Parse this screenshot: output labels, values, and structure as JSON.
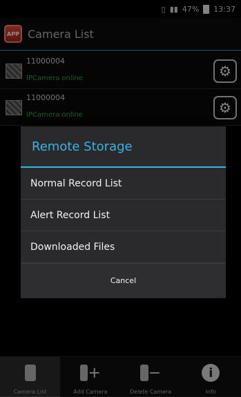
{
  "status_bar": {
    "battery": "47%",
    "time": "13:37"
  },
  "app_bar": {
    "logo_text": "APP",
    "title": "Camera List"
  },
  "cameras": [
    {
      "id": "11000004",
      "status": "IPCamera online"
    },
    {
      "id": "11000004",
      "status": "IPCamera online"
    }
  ],
  "dialog": {
    "title": "Remote Storage",
    "items": [
      "Normal Record List",
      "Alert Record List",
      "Downloaded Files"
    ],
    "cancel_label": "Cancel"
  },
  "tabs": [
    {
      "label": "Camera List",
      "icon": "camera-icon"
    },
    {
      "label": "Add Camera",
      "icon": "add-camera-icon"
    },
    {
      "label": "Delete Camera",
      "icon": "delete-camera-icon"
    },
    {
      "label": "Info",
      "icon": "info-icon"
    }
  ],
  "colors": {
    "accent": "#35b5e5",
    "online": "#2fa84a",
    "dialog_bg": "#2a2a2c"
  }
}
